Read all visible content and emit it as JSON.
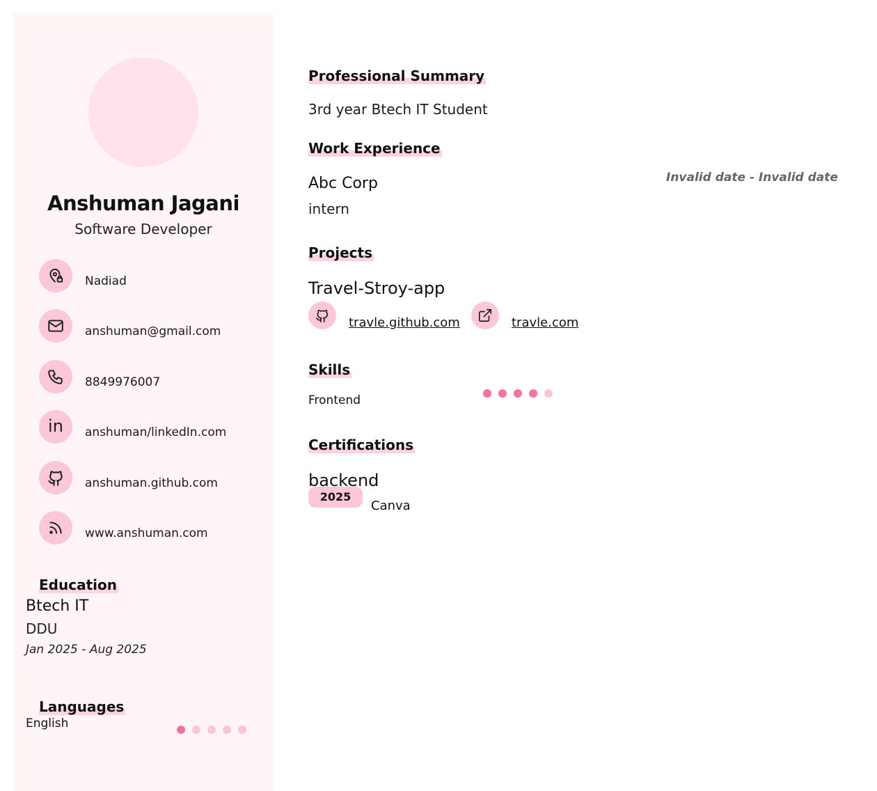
{
  "profile": {
    "name": "Anshuman Jagani",
    "title": "Software Developer"
  },
  "contacts": [
    {
      "icon": "location-icon",
      "text": "Nadiad"
    },
    {
      "icon": "mail-icon",
      "text": "anshuman@gmail.com"
    },
    {
      "icon": "phone-icon",
      "text": "8849976007"
    },
    {
      "icon": "linkedin-icon",
      "glyph": "in",
      "text": "anshuman/linkedIn.com"
    },
    {
      "icon": "github-icon",
      "text": "anshuman.github.com"
    },
    {
      "icon": "rss-icon",
      "text": "www.anshuman.com"
    }
  ],
  "education": {
    "heading": "Education",
    "degree": "Btech IT",
    "school": "DDU",
    "dates": "Jan 2025 - Aug 2025"
  },
  "languages": {
    "heading": "Languages",
    "items": [
      {
        "name": "English",
        "level": 1,
        "max": 5
      }
    ]
  },
  "summary": {
    "heading": "Professional Summary",
    "text": "3rd year Btech IT Student"
  },
  "work": {
    "heading": "Work Experience",
    "items": [
      {
        "company": "Abc Corp",
        "position": "intern",
        "dates": "Invalid date - Invalid date"
      }
    ]
  },
  "projects": {
    "heading": "Projects",
    "items": [
      {
        "title": "Travel-Stroy-app",
        "repo": "travle.github.com",
        "site": "travle.com"
      }
    ]
  },
  "skills": {
    "heading": "Skills",
    "items": [
      {
        "name": "Frontend",
        "level": 4,
        "max": 5
      }
    ]
  },
  "certifications": {
    "heading": "Certifications",
    "items": [
      {
        "title": "backend",
        "year": "2025",
        "issuer": "Canva"
      }
    ]
  },
  "colors": {
    "sidebar_bg": "#fff4f6",
    "accent": "#fcc8d8",
    "dot_active": "#f2739c",
    "dot_inactive": "#f9c6d6",
    "avatar": "#ffe2ec"
  }
}
